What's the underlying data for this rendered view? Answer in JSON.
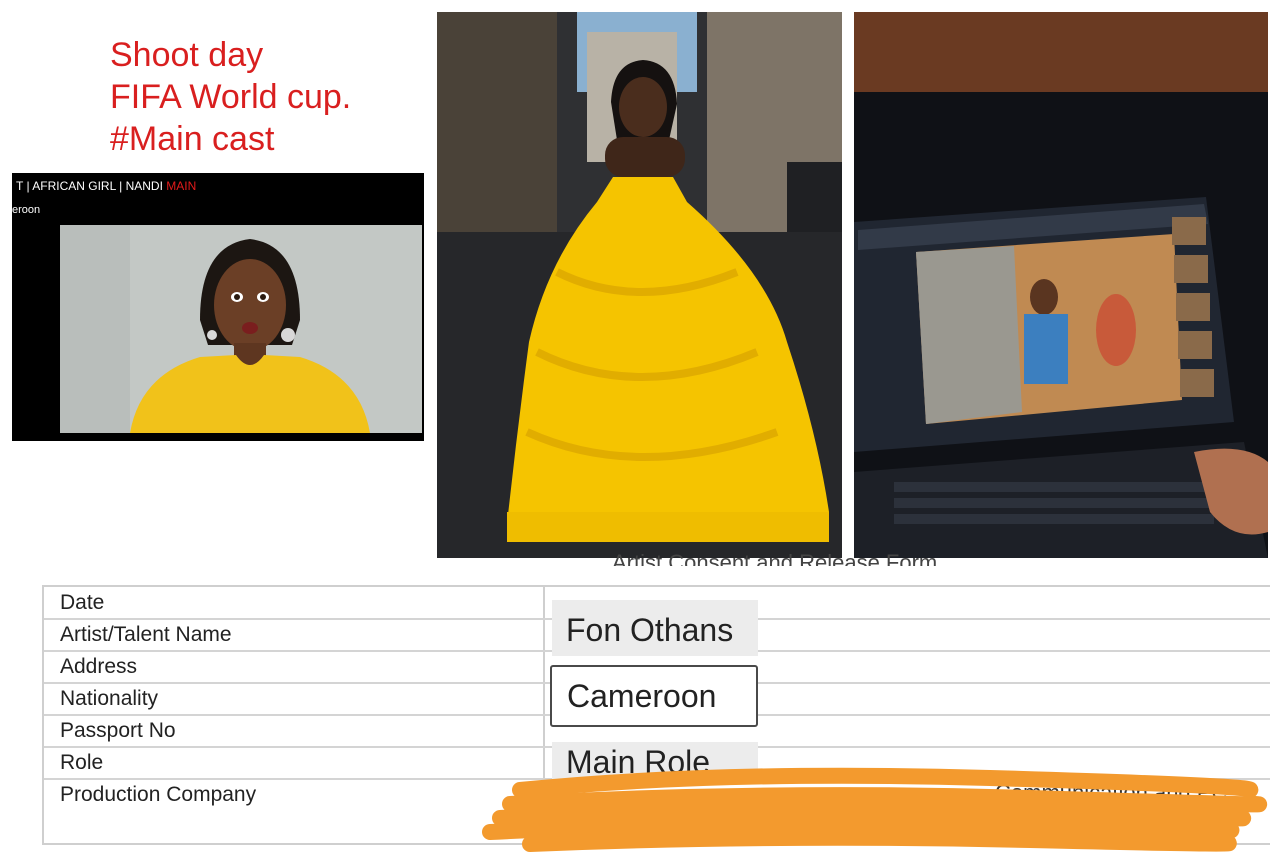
{
  "caption": {
    "line1": "Shoot day",
    "line2": "FIFA World cup.",
    "line3": "#Main cast"
  },
  "video": {
    "title_prefix": "T | AFRICAN GIRL | NANDI ",
    "title_highlight": "MAIN",
    "subtitle": "eroon"
  },
  "form": {
    "title": "Artist Consent and Release Form",
    "rows": [
      {
        "label": "Date",
        "value": ""
      },
      {
        "label": "Artist/Talent Name",
        "value": "Fon Othans"
      },
      {
        "label": "Address",
        "value": ""
      },
      {
        "label": "Nationality",
        "value": "Cameroon"
      },
      {
        "label": "Passport No",
        "value": ""
      },
      {
        "label": "Role",
        "value": "Main Role"
      },
      {
        "label": "Production Company",
        "value": ""
      }
    ],
    "redacted_fragment": "Communication and PC"
  },
  "colors": {
    "caption": "#d91f1f",
    "dress": "#f5c400",
    "redaction": "#f39a2e"
  }
}
